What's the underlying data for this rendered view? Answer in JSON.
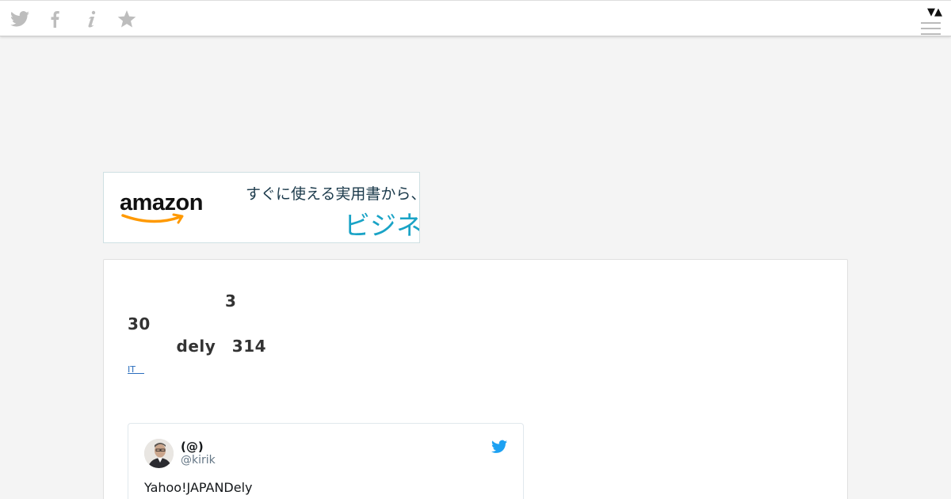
{
  "toolbar": {
    "icons": [
      "twitter-icon",
      "facebook-icon",
      "info-icon",
      "star-icon"
    ],
    "sort_glyph": "▼▲",
    "menu_icon": "hamburger-menu-icon"
  },
  "ad": {
    "logo_text": "amazon",
    "line1": "すぐに使える実用書から、書",
    "line2": "ビジネス",
    "colors": {
      "logo": "#111111",
      "smile": "#ff9900",
      "line1": "#1b3a4b",
      "line2": "#19a3c6"
    }
  },
  "article": {
    "title_lines": [
      "　　　　　　3　　　　　30",
      "　　　dely　314　　　",
      "　　　　"
    ],
    "category": "IT　"
  },
  "tweet": {
    "name": "(@)",
    "handle": "@kirik",
    "text": "Yahoo!JAPANDely",
    "colors": {
      "bird": "#1da1f2"
    }
  },
  "colors": {
    "background": "#f4f4f4",
    "card": "#ffffff",
    "icon_gray": "#bdbdbd",
    "link": "#2a6dbd"
  }
}
